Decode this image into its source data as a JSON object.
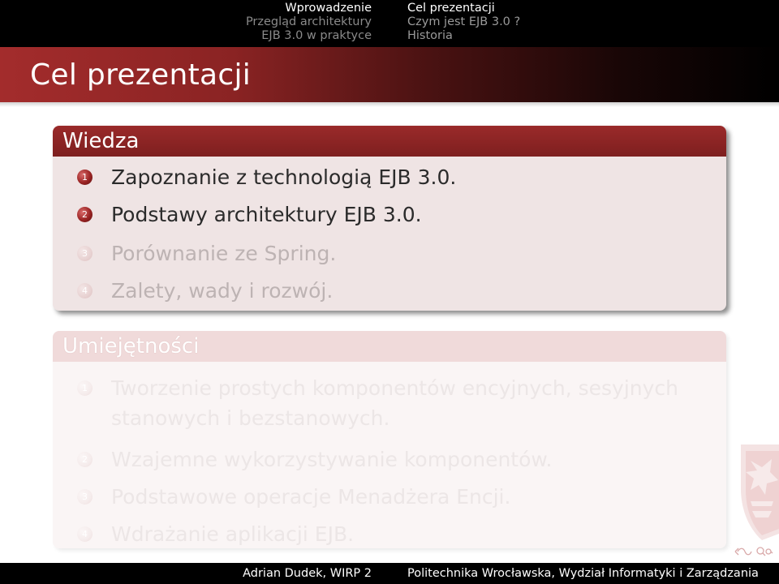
{
  "nav": {
    "left": [
      "Wprowadzenie",
      "Przegląd architektury",
      "EJB 3.0 w praktyce"
    ],
    "right": [
      "Cel prezentacji",
      "Czym jest EJB 3.0 ?",
      "Historia"
    ]
  },
  "frame_title": "Cel prezentacji",
  "blocks": [
    {
      "title": "Wiedza",
      "items": [
        {
          "num": "1",
          "text": "Zapoznanie z technologią EJB 3.0."
        },
        {
          "num": "2",
          "text": "Podstawy architektury EJB 3.0."
        },
        {
          "num": "3",
          "text": "Porównanie ze Spring."
        },
        {
          "num": "4",
          "text": "Zalety, wady i rozwój."
        }
      ]
    },
    {
      "title": "Umiejętności",
      "items": [
        {
          "num": "1",
          "line1": "Tworzenie prostych komponentów encyjnych, sesyjnych",
          "line2": "stanowych i bezstanowych."
        },
        {
          "num": "2",
          "text": "Wzajemne wykorzystywanie komponentów."
        },
        {
          "num": "3",
          "text": "Podstawowe operacje Menadżera Encji."
        },
        {
          "num": "4",
          "text": "Wdrażanie aplikacji EJB."
        }
      ]
    }
  ],
  "footer": {
    "left": "Adrian Dudek, WIRP 2",
    "right": "Politechnika Wrocławska, Wydział Informatyki i Zarządzania"
  },
  "colors": {
    "accent": "#9a2a2a",
    "topbar": "#000000",
    "block_body": "#efe4e4"
  },
  "icons": [
    "navigation-loop-icon",
    "search-icon"
  ]
}
